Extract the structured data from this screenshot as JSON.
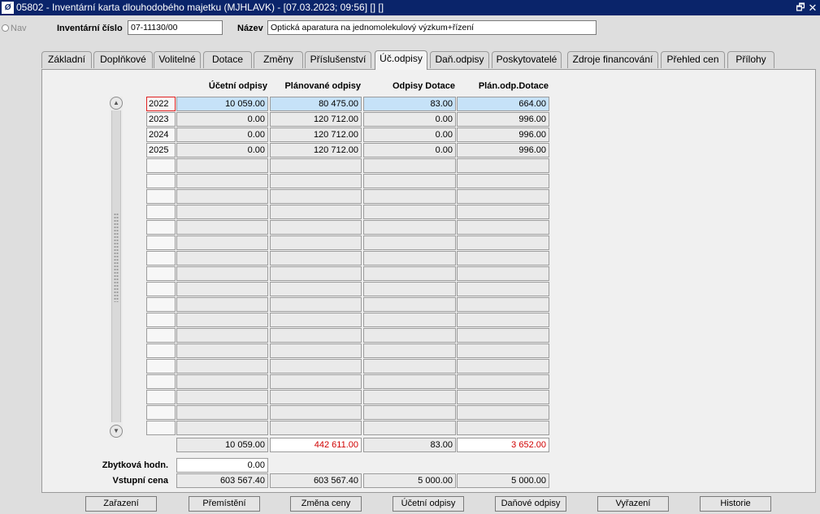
{
  "titlebar": {
    "app_icon": "Ø",
    "title": "05802 - Inventární karta dlouhodobého majetku (MJHLAVK) - [07.03.2023; 09:56] [] []",
    "restore_glyph": "🗗",
    "close_glyph": "✕"
  },
  "nav": {
    "label": "Nav"
  },
  "header": {
    "inv_label": "Inventární číslo",
    "inv_value": "07-11130/00",
    "name_label": "Název",
    "name_value": "Optická aparatura na jednomolekulový výzkum+řízení"
  },
  "tabs": [
    {
      "label": "Základní"
    },
    {
      "label": "Doplňkové"
    },
    {
      "label": "Volitelné"
    },
    {
      "label": "Dotace"
    },
    {
      "label": "Změny"
    },
    {
      "label": "Příslušenství"
    },
    {
      "label": "Úč.odpisy"
    },
    {
      "label": "Daň.odpisy"
    },
    {
      "label": "Poskytovatelé"
    },
    {
      "label": "Zdroje financování"
    },
    {
      "label": "Přehled cen"
    },
    {
      "label": "Přílohy"
    }
  ],
  "active_tab": "Úč.odpisy",
  "table": {
    "columns": [
      "Účetní odpisy",
      "Plánované odpisy",
      "Odpisy Dotace",
      "Plán.odp.Dotace"
    ],
    "rows": [
      [
        "2022",
        "10 059.00",
        "80 475.00",
        "83.00",
        "664.00"
      ],
      [
        "2023",
        "0.00",
        "120 712.00",
        "0.00",
        "996.00"
      ],
      [
        "2024",
        "0.00",
        "120 712.00",
        "0.00",
        "996.00"
      ],
      [
        "2025",
        "0.00",
        "120 712.00",
        "0.00",
        "996.00"
      ]
    ],
    "totals": [
      "10 059.00",
      "442 611.00",
      "83.00",
      "3 652.00"
    ],
    "totals_alert_color": "#d00000"
  },
  "summary": {
    "residual_label": "Zbytková hodn.",
    "residual_value": "0.00",
    "entry_label": "Vstupní cena",
    "entry_values": [
      "603 567.40",
      "603 567.40",
      "5 000.00",
      "5 000.00"
    ]
  },
  "scroll": {
    "up_icon": "▲",
    "down_icon": "▼"
  },
  "buttons": [
    {
      "label": "Zařazení"
    },
    {
      "label": "Přemístění"
    },
    {
      "label": "Změna ceny"
    },
    {
      "label": "Účetní odpisy"
    },
    {
      "label": "Daňové odpisy"
    },
    {
      "label": "Vyřazení"
    },
    {
      "label": "Historie"
    }
  ]
}
